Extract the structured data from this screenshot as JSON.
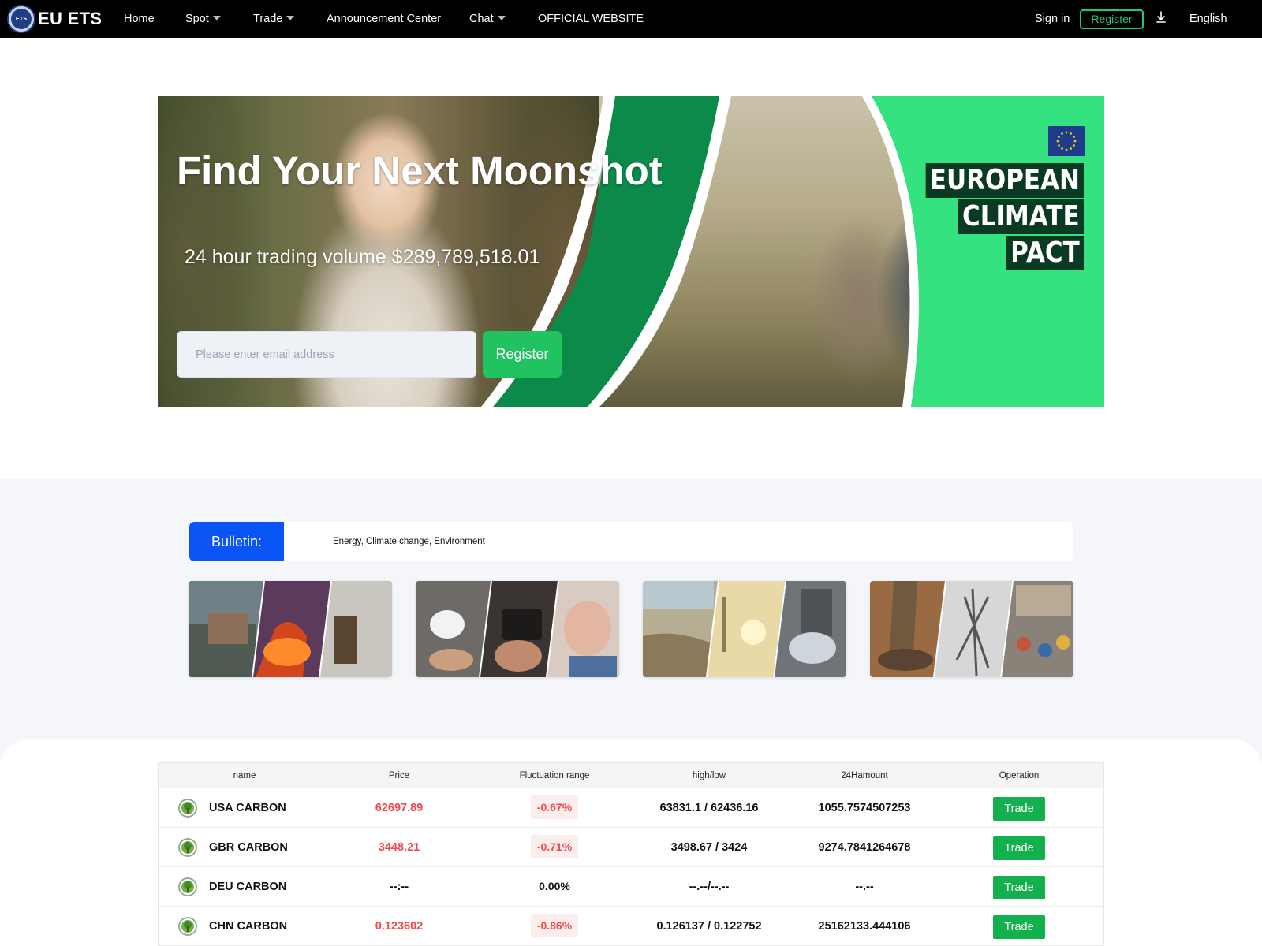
{
  "nav": {
    "brand": "EU ETS",
    "logo_text": "ETS",
    "items": [
      "Home",
      "Spot",
      "Trade",
      "Announcement Center",
      "Chat",
      "OFFICIAL WEBSITE"
    ],
    "sign_in": "Sign in",
    "register": "Register",
    "language": "English"
  },
  "hero": {
    "title": "Find Your Next Moonshot",
    "subtitle": "24 hour trading volume $289,789,518.01",
    "email_placeholder": "Please enter email address",
    "register_button": "Register",
    "pact_lines": [
      "EUROPEAN",
      "CLIMATE",
      "PACT"
    ]
  },
  "bulletin": {
    "label": "Bulletin:",
    "text": "Energy, Climate change, Environment"
  },
  "market": {
    "headers": [
      "name",
      "Price",
      "Fluctuation range",
      "high/low",
      "24Hamount",
      "Operation"
    ],
    "trade_label": "Trade",
    "rows": [
      {
        "name": "USA CARBON",
        "price": "62697.89",
        "change": "-0.67%",
        "highlow": "63831.1 / 62436.16",
        "amount": "1055.7574507253",
        "trend": "down"
      },
      {
        "name": "GBR CARBON",
        "price": "3448.21",
        "change": "-0.71%",
        "highlow": "3498.67 / 3424",
        "amount": "9274.7841264678",
        "trend": "down"
      },
      {
        "name": "DEU CARBON",
        "price": "--:--",
        "change": "0.00%",
        "highlow": "--.--/--.--",
        "amount": "--.--",
        "trend": "flat"
      },
      {
        "name": "CHN CARBON",
        "price": "0.123602",
        "change": "-0.86%",
        "highlow": "0.126137 / 0.122752",
        "amount": "25162133.444106",
        "trend": "down"
      }
    ]
  },
  "colors": {
    "accent_green": "#21c260",
    "bulletin_blue": "#0b54f5",
    "down_red": "#f04a4a",
    "pact_green": "#34e27f",
    "dark_green": "#0b8a4a"
  },
  "icons": {
    "download": "download-icon",
    "nav_caret": "caret-down-icon",
    "coin": "tree-coin-icon",
    "eu_flag": "eu-flag-icon"
  }
}
